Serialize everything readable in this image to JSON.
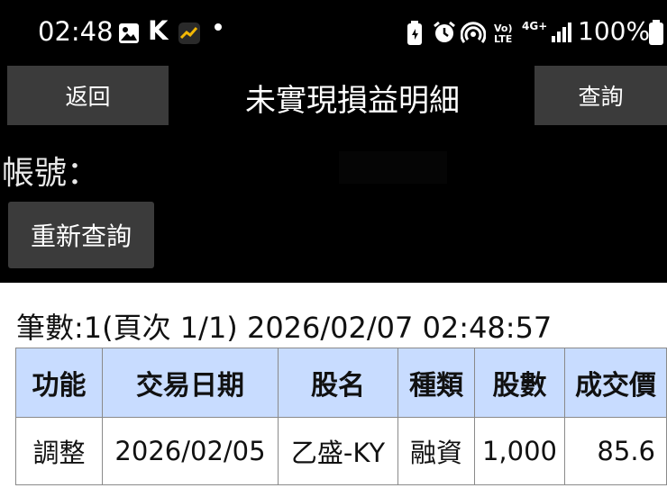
{
  "status_bar": {
    "time": "02:48",
    "battery": "100%",
    "network": "4G+",
    "volte": "Vo) LTE",
    "icons": [
      "image-icon",
      "k-app-icon",
      "stock-chart-icon",
      "dot-icon",
      "battery-saver-icon",
      "alarm-icon",
      "hotspot-icon",
      "volte-icon",
      "network-4g-icon",
      "signal-icon",
      "battery-icon"
    ]
  },
  "app_bar": {
    "back_label": "返回",
    "title": "未實現損益明細",
    "query_label": "查詢"
  },
  "account": {
    "label": "帳號："
  },
  "requery_label": "重新查詢",
  "summary": "筆數:1(頁次 1/1) 2026/02/07 02:48:57",
  "table": {
    "headers": [
      "功能",
      "交易日期",
      "股名",
      "種類",
      "股數",
      "成交價"
    ],
    "rows": [
      {
        "action": "調整",
        "date": "2026/02/05",
        "stock": "乙盛-KY",
        "type": "融資",
        "shares": "1,000",
        "price": "85.6"
      }
    ]
  },
  "colors": {
    "header_bg": "#c8dcff",
    "stock_link": "#1a3ccf",
    "button_bg": "#3b3b3b"
  }
}
